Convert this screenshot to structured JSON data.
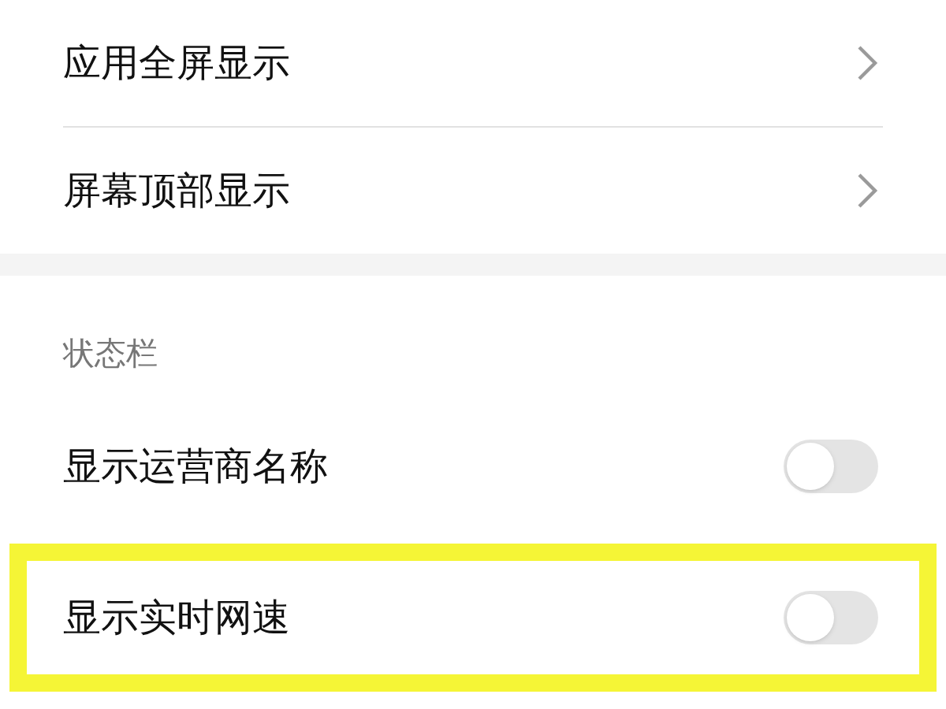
{
  "groups": [
    {
      "items": [
        {
          "kind": "link",
          "label": "应用全屏显示"
        },
        {
          "kind": "link",
          "label": "屏幕顶部显示"
        }
      ]
    },
    {
      "header": "状态栏",
      "items": [
        {
          "kind": "toggle",
          "label": "显示运营商名称",
          "on": false,
          "highlighted": false
        },
        {
          "kind": "toggle",
          "label": "显示实时网速",
          "on": false,
          "highlighted": true
        }
      ]
    }
  ]
}
